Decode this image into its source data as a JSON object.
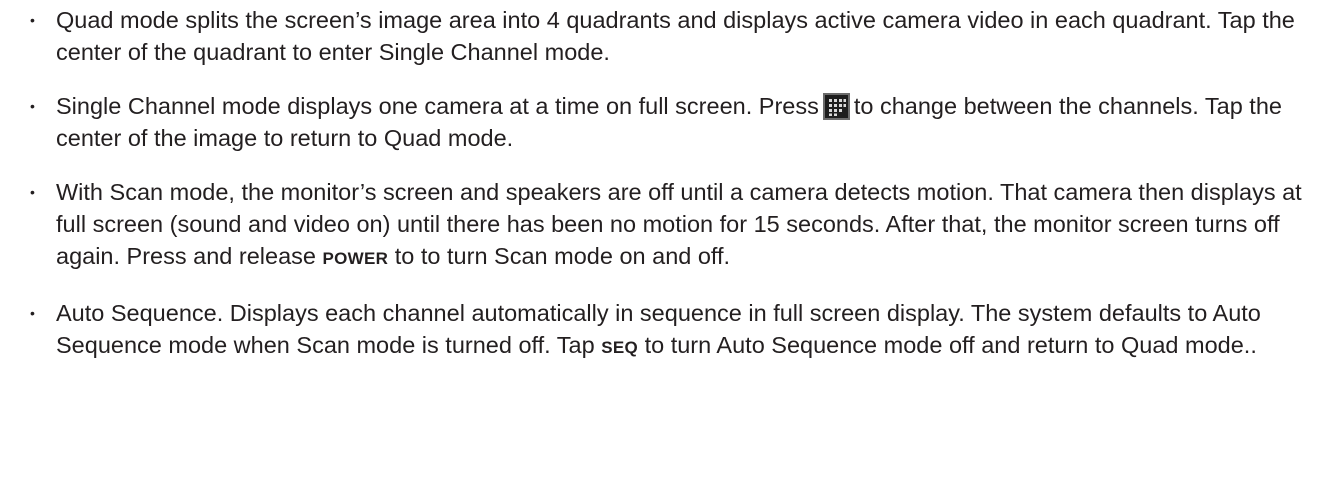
{
  "items": [
    {
      "segments": [
        "Quad mode splits the screen’s image area into 4 quadrants and displays active camera video in each quadrant. Tap the center of the quadrant to enter Single Channel mode."
      ]
    },
    {
      "segments": [
        "Single Channel mode displays one camera at a time on full screen. Press",
        "to change between the channels. Tap the center of the image to return to Quad mode."
      ],
      "icon": "grid-channel-icon"
    },
    {
      "segments": [
        "With Scan mode, the monitor’s screen and speakers are off until a camera detects motion. That camera then displays at full screen (sound and video on) until there has been no motion for 15 seconds. After that, the monitor screen turns off again. Press and release",
        "POWER",
        "to to turn Scan mode on and off."
      ]
    },
    {
      "segments": [
        "Auto Sequence. Displays each channel automatically in sequence in full screen display.  The system defaults to Auto Sequence mode when Scan mode is turned off. Tap",
        "SEQ",
        "to turn Auto Sequence mode off and return to Quad mode.."
      ]
    }
  ],
  "bullet_char": "•"
}
